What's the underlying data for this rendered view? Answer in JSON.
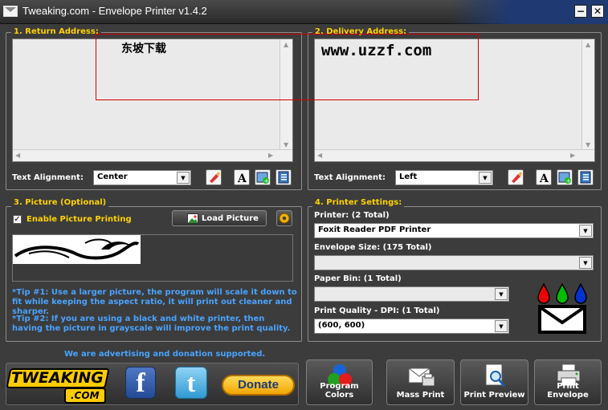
{
  "window": {
    "title": "Tweaking.com - Envelope Printer v1.4.2",
    "minimize_glyph": "−",
    "close_glyph": "✕"
  },
  "return_address": {
    "title": "1. Return Address:",
    "text": "东坡下载",
    "alignment_label": "Text Alignment:",
    "alignment_value": "Center"
  },
  "delivery_address": {
    "title": "2. Delivery Address:",
    "text": "www.uzzf.com",
    "alignment_label": "Text Alignment:",
    "alignment_value": "Left"
  },
  "picture": {
    "title": "3. Picture (Optional)",
    "enable_label": "Enable Picture Printing",
    "enabled": true,
    "load_button": "Load Picture",
    "tip1": "*Tip #1: Use a larger picture, the program will scale it down to fit while keeping the aspect ratio, it will print out cleaner and sharper.",
    "tip2": "*Tip #2: If you are using a black and white printer, then having the picture in grayscale will improve the print quality."
  },
  "printer_settings": {
    "title": "4. Printer Settings:",
    "printer_label": "Printer: (2 Total)",
    "printer_value": "Foxit Reader PDF Printer",
    "envelope_label": "Envelope Size: (175 Total)",
    "envelope_value": "",
    "bin_label": "Paper Bin: (1 Total)",
    "bin_value": "",
    "dpi_label": "Print Quality - DPI: (1 Total)",
    "dpi_value": "(600, 600)"
  },
  "footer": {
    "support_text": "We are advertising and donation supported.",
    "logo_text_top": "TWEAKING",
    "logo_text_bottom": ".COM",
    "facebook_glyph": "f",
    "twitter_glyph": "t",
    "donate_label": "Donate",
    "buttons": {
      "program_colors": "Program Colors",
      "mass_print": "Mass Print",
      "print_preview": "Print Preview",
      "print_envelope": "Print Envelope"
    }
  },
  "colors": {
    "accent_yellow": "#ffd200",
    "tip_blue": "#4aa3ff",
    "background": "#3c3c3c"
  }
}
